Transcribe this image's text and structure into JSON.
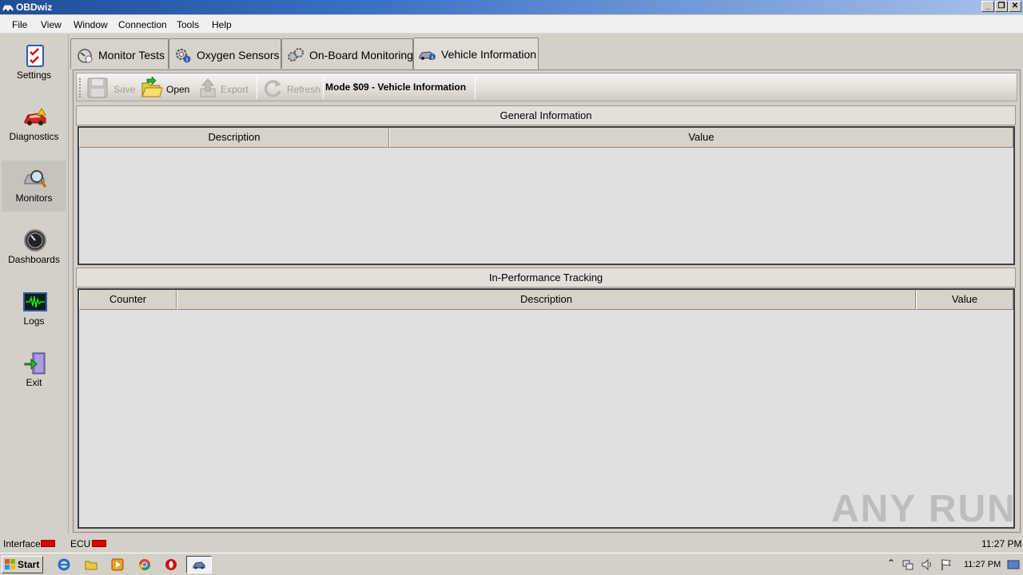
{
  "window": {
    "title": "OBDwiz",
    "controls": [
      "minimize",
      "restore",
      "close"
    ]
  },
  "menu": [
    "File",
    "View",
    "Window",
    "Connection",
    "Tools",
    "Help"
  ],
  "sidebar": {
    "items": [
      {
        "label": "Settings",
        "icon": "settings-checklist-icon"
      },
      {
        "label": "Diagnostics",
        "icon": "car-diagnostics-icon"
      },
      {
        "label": "Monitors",
        "icon": "magnifier-monitor-icon",
        "active": true
      },
      {
        "label": "Dashboards",
        "icon": "gauge-icon"
      },
      {
        "label": "Logs",
        "icon": "waveform-log-icon"
      },
      {
        "label": "Exit",
        "icon": "exit-door-icon"
      }
    ]
  },
  "tabs": [
    {
      "label": "Monitor Tests",
      "icon": "gauge-check-icon"
    },
    {
      "label": "Oxygen Sensors",
      "icon": "gear-info-icon"
    },
    {
      "label": "On-Board Monitoring",
      "icon": "gears-icon"
    },
    {
      "label": "Vehicle Information",
      "icon": "car-info-icon",
      "active": true
    }
  ],
  "toolbar": {
    "save": "Save",
    "open": "Open",
    "export": "Export",
    "refresh": "Refresh",
    "mode": "Mode $09 - Vehicle Information"
  },
  "general_info": {
    "title": "General Information",
    "columns": [
      "Description",
      "Value"
    ],
    "rows": []
  },
  "ipt": {
    "title": "In-Performance Tracking",
    "columns": [
      "Counter",
      "Description",
      "Value"
    ],
    "rows": []
  },
  "status": {
    "interface_label": "Interface",
    "ecu_label": "ECU",
    "time": "11:27 PM",
    "led_color": "#e00000"
  },
  "taskbar": {
    "start": "Start",
    "clock": "11:27 PM",
    "pinned": [
      "ie-icon",
      "folder-icon",
      "media-player-icon",
      "chrome-icon",
      "opera-icon",
      "obdwiz-icon"
    ]
  },
  "watermark": "ANY RUN"
}
